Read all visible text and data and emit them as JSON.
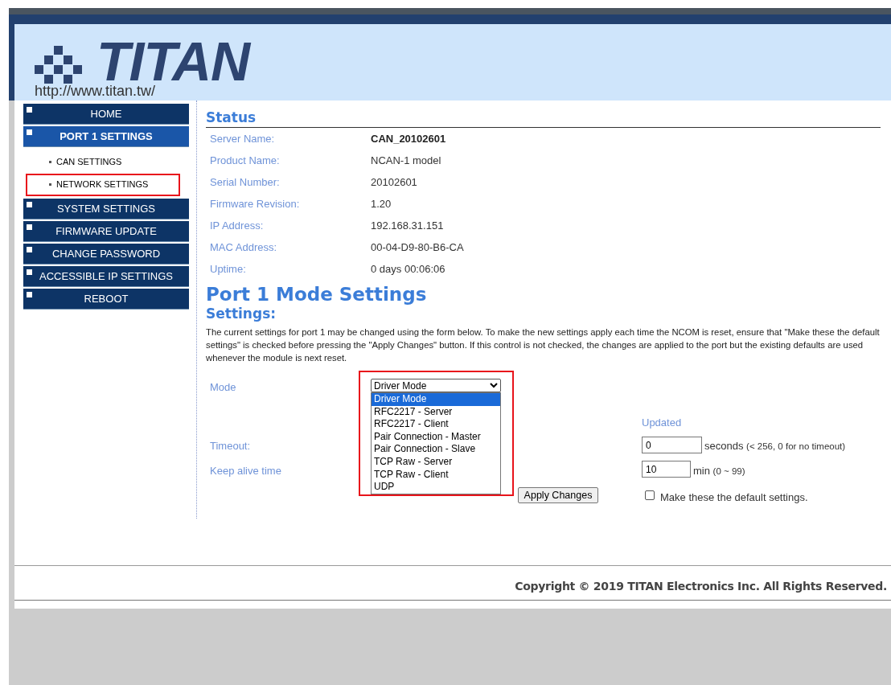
{
  "header": {
    "logo_text": "TITAN",
    "url": "http://www.titan.tw/"
  },
  "sidebar": {
    "items": [
      {
        "label": "HOME",
        "selected": false
      },
      {
        "label": "PORT 1 SETTINGS",
        "selected": true,
        "children": [
          {
            "label": "CAN SETTINGS",
            "highlighted": false
          },
          {
            "label": "NETWORK SETTINGS",
            "highlighted": true
          }
        ]
      },
      {
        "label": "SYSTEM SETTINGS",
        "selected": false
      },
      {
        "label": "FIRMWARE UPDATE",
        "selected": false
      },
      {
        "label": "CHANGE PASSWORD",
        "selected": false
      },
      {
        "label": "ACCESSIBLE IP SETTINGS",
        "selected": false
      },
      {
        "label": "REBOOT",
        "selected": false
      }
    ]
  },
  "status": {
    "title": "Status",
    "rows": [
      {
        "label": "Server Name:",
        "value": "CAN_20102601",
        "bold": true
      },
      {
        "label": "Product Name:",
        "value": "NCAN-1 model",
        "bold": false
      },
      {
        "label": "Serial Number:",
        "value": "20102601",
        "bold": false
      },
      {
        "label": "Firmware Revision:",
        "value": "1.20",
        "bold": false
      },
      {
        "label": "IP Address:",
        "value": "192.168.31.151",
        "bold": false
      },
      {
        "label": "MAC Address:",
        "value": "00-04-D9-80-B6-CA",
        "bold": false
      },
      {
        "label": "Uptime:",
        "value": "0 days 00:06:06",
        "bold": false
      }
    ]
  },
  "settings": {
    "title": "Port 1 Mode Settings",
    "subtitle": "Settings:",
    "description": "The current settings for port 1 may be changed using the form below. To make the new settings apply each time the NCOM is reset, ensure that \"Make these the default settings\" is checked before pressing the \"Apply Changes\" button. If this control is not checked, the changes are applied to the port but the existing defaults are used whenever the module is next reset.",
    "mode": {
      "label": "Mode",
      "value": "Driver Mode",
      "expanded": true,
      "highlighted": true,
      "options": [
        {
          "label": "Driver Mode",
          "selected": true
        },
        {
          "label": "RFC2217 - Server",
          "selected": false
        },
        {
          "label": "RFC2217 - Client",
          "selected": false
        },
        {
          "label": "Pair Connection - Master",
          "selected": false
        },
        {
          "label": "Pair Connection - Slave",
          "selected": false
        },
        {
          "label": "TCP Raw - Server",
          "selected": false
        },
        {
          "label": "TCP Raw - Client",
          "selected": false
        },
        {
          "label": "UDP",
          "selected": false
        }
      ]
    },
    "status_note": "Updated",
    "timeout": {
      "label": "Timeout:",
      "value": "0",
      "unit": "seconds",
      "hint": "(< 256, 0 for no timeout)"
    },
    "keep_alive": {
      "label": "Keep alive time",
      "value": "10",
      "unit": "min",
      "hint": "(0 ~ 99)"
    },
    "apply_button": "Apply Changes",
    "default_checkbox": {
      "label": "Make these the default settings.",
      "checked": false
    }
  },
  "footer": {
    "copyright": "Copyright © 2019 TITAN Electronics Inc. All Rights Reserved."
  }
}
